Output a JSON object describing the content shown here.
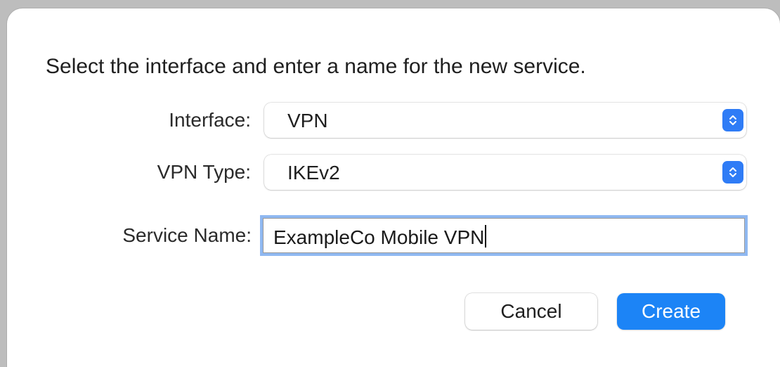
{
  "dialog": {
    "prompt": "Select the interface and enter a name for the new service.",
    "interface": {
      "label": "Interface:",
      "value": "VPN",
      "icon": "chevron-up-down-icon"
    },
    "vpn_type": {
      "label": "VPN Type:",
      "value": "IKEv2",
      "icon": "chevron-up-down-icon"
    },
    "service_name": {
      "label": "Service Name:",
      "value": "ExampleCo Mobile VPN"
    },
    "buttons": {
      "cancel": "Cancel",
      "create": "Create"
    }
  },
  "colors": {
    "accent": "#1c84f6",
    "focus_ring": "#8fb8f1"
  }
}
